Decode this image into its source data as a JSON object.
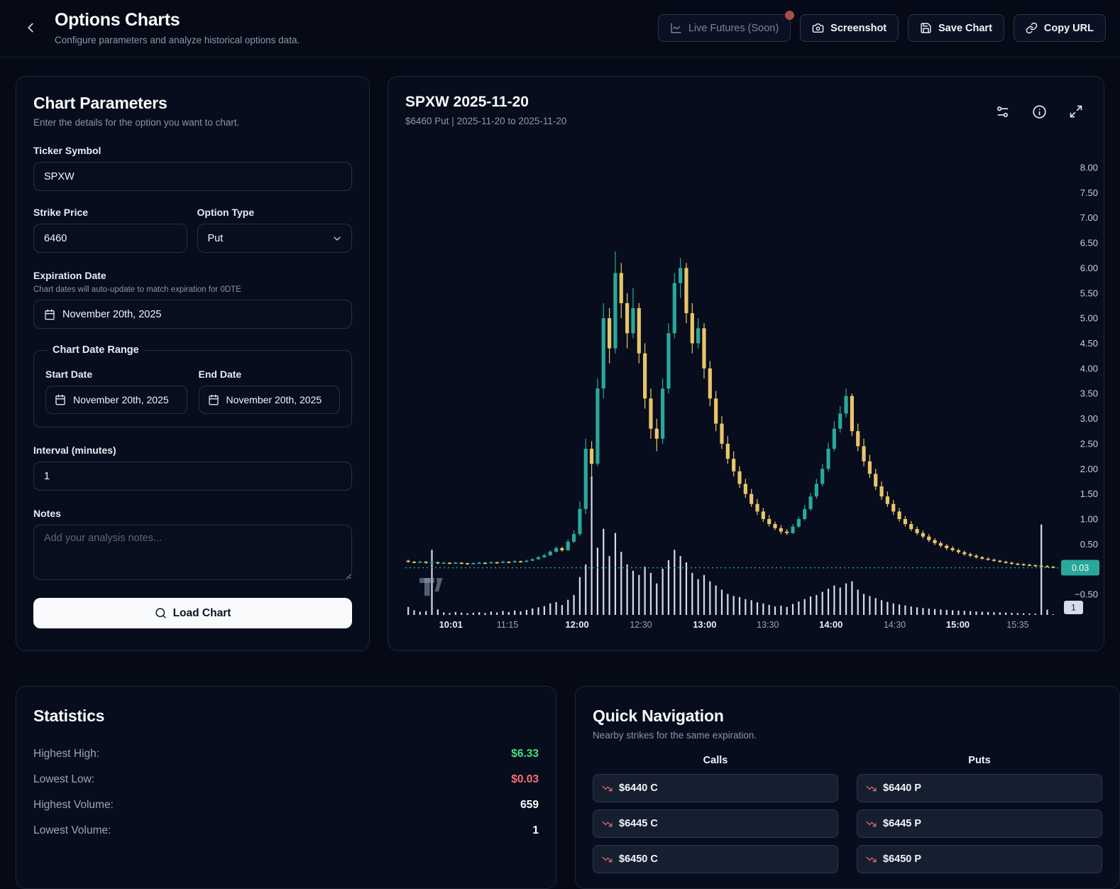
{
  "header": {
    "title": "Options Charts",
    "subtitle": "Configure parameters and analyze historical options data.",
    "live_futures_label": "Live Futures (Soon)",
    "screenshot_label": "Screenshot",
    "save_chart_label": "Save Chart",
    "copy_url_label": "Copy URL",
    "notification_dot_color": "#a84e4b"
  },
  "parameters": {
    "title": "Chart Parameters",
    "subtitle": "Enter the details for the option you want to chart.",
    "ticker_label": "Ticker Symbol",
    "ticker_value": "SPXW",
    "strike_label": "Strike Price",
    "strike_value": "6460",
    "option_type_label": "Option Type",
    "option_type_value": "Put",
    "expiration_label": "Expiration Date",
    "expiration_hint": "Chart dates will auto-update to match expiration for 0DTE",
    "expiration_value": "November 20th, 2025",
    "range_label": "Chart Date Range",
    "start_label": "Start Date",
    "start_value": "November 20th, 2025",
    "end_label": "End Date",
    "end_value": "November 20th, 2025",
    "interval_label": "Interval (minutes)",
    "interval_value": "1",
    "notes_label": "Notes",
    "notes_placeholder": "Add your analysis notes...",
    "load_button_label": "Load Chart"
  },
  "chart": {
    "title": "SPXW 2025-11-20",
    "subtitle": "$6460 Put | 2025-11-20 to 2025-11-20",
    "icons": [
      "settings-sliders",
      "info-circle",
      "maximize"
    ]
  },
  "chart_data": {
    "type": "candlestick",
    "title": "SPXW 2025-11-20 $6460 Put intraday",
    "ylim": [
      -0.9,
      8.55
    ],
    "grid": false,
    "legend_position": "none",
    "up_color": "#2aa79b",
    "down_color": "#e9c46a",
    "volume_color": "rgba(233,238,245,0.92)",
    "last_price": 0.03,
    "last_price_label": "0.03",
    "last_volume_label": "1",
    "price_line_style": "dotted",
    "y_ticks": [
      {
        "v": 8.0,
        "label": "8.00"
      },
      {
        "v": 7.5,
        "label": "7.50"
      },
      {
        "v": 7.0,
        "label": "7.00"
      },
      {
        "v": 6.5,
        "label": "6.50"
      },
      {
        "v": 6.0,
        "label": "6.00"
      },
      {
        "v": 5.5,
        "label": "5.50"
      },
      {
        "v": 5.0,
        "label": "5.00"
      },
      {
        "v": 4.5,
        "label": "4.50"
      },
      {
        "v": 4.0,
        "label": "4.00"
      },
      {
        "v": 3.5,
        "label": "3.50"
      },
      {
        "v": 3.0,
        "label": "3.00"
      },
      {
        "v": 2.5,
        "label": "2.50"
      },
      {
        "v": 2.0,
        "label": "2.00"
      },
      {
        "v": 1.5,
        "label": "1.50"
      },
      {
        "v": 1.0,
        "label": "1.00"
      },
      {
        "v": 0.5,
        "label": "0.50"
      },
      {
        "v": -0.5,
        "label": "−0.50"
      }
    ],
    "x_ticks": [
      {
        "f": 0.07,
        "label": "10:01",
        "bold": true
      },
      {
        "f": 0.157,
        "label": "11:15",
        "bold": false
      },
      {
        "f": 0.264,
        "label": "12:00",
        "bold": true
      },
      {
        "f": 0.362,
        "label": "12:30",
        "bold": false
      },
      {
        "f": 0.46,
        "label": "13:00",
        "bold": true
      },
      {
        "f": 0.557,
        "label": "13:30",
        "bold": false
      },
      {
        "f": 0.654,
        "label": "14:00",
        "bold": true
      },
      {
        "f": 0.752,
        "label": "14:30",
        "bold": false
      },
      {
        "f": 0.849,
        "label": "15:00",
        "bold": true
      },
      {
        "f": 0.941,
        "label": "15:35",
        "bold": false
      }
    ],
    "ohlcv_format": [
      "open",
      "high",
      "low",
      "close",
      "volume"
    ],
    "candles": [
      [
        0.17,
        0.19,
        0.13,
        0.15,
        38
      ],
      [
        0.15,
        0.16,
        0.12,
        0.14,
        22
      ],
      [
        0.14,
        0.17,
        0.13,
        0.15,
        15
      ],
      [
        0.15,
        0.16,
        0.11,
        0.13,
        18
      ],
      [
        0.13,
        0.16,
        0.1,
        0.14,
        310
      ],
      [
        0.14,
        0.15,
        0.1,
        0.12,
        26
      ],
      [
        0.12,
        0.15,
        0.11,
        0.13,
        12
      ],
      [
        0.13,
        0.14,
        0.1,
        0.12,
        9
      ],
      [
        0.12,
        0.15,
        0.11,
        0.13,
        14
      ],
      [
        0.13,
        0.14,
        0.1,
        0.12,
        11
      ],
      [
        0.12,
        0.13,
        0.09,
        0.11,
        8
      ],
      [
        0.11,
        0.14,
        0.1,
        0.12,
        10
      ],
      [
        0.12,
        0.15,
        0.11,
        0.13,
        13
      ],
      [
        0.13,
        0.14,
        0.1,
        0.12,
        9
      ],
      [
        0.12,
        0.16,
        0.11,
        0.14,
        16
      ],
      [
        0.14,
        0.15,
        0.11,
        0.13,
        12
      ],
      [
        0.13,
        0.17,
        0.12,
        0.15,
        19
      ],
      [
        0.15,
        0.16,
        0.12,
        0.14,
        14
      ],
      [
        0.14,
        0.18,
        0.13,
        0.16,
        21
      ],
      [
        0.16,
        0.17,
        0.13,
        0.15,
        17
      ],
      [
        0.15,
        0.19,
        0.14,
        0.17,
        24
      ],
      [
        0.17,
        0.22,
        0.16,
        0.2,
        31
      ],
      [
        0.2,
        0.26,
        0.19,
        0.24,
        36
      ],
      [
        0.24,
        0.31,
        0.22,
        0.28,
        42
      ],
      [
        0.28,
        0.38,
        0.26,
        0.35,
        55
      ],
      [
        0.35,
        0.46,
        0.33,
        0.42,
        61
      ],
      [
        0.42,
        0.45,
        0.35,
        0.38,
        47
      ],
      [
        0.38,
        0.6,
        0.36,
        0.55,
        72
      ],
      [
        0.55,
        0.78,
        0.52,
        0.7,
        95
      ],
      [
        0.7,
        1.35,
        0.66,
        1.2,
        180
      ],
      [
        1.2,
        2.6,
        1.1,
        2.4,
        240
      ],
      [
        2.4,
        2.55,
        1.85,
        2.1,
        659
      ],
      [
        2.1,
        3.8,
        2.05,
        3.6,
        320
      ],
      [
        3.6,
        5.3,
        3.4,
        5.0,
        410
      ],
      [
        5.0,
        5.2,
        4.1,
        4.4,
        280
      ],
      [
        4.4,
        6.33,
        4.3,
        5.9,
        390
      ],
      [
        5.9,
        6.1,
        5.0,
        5.3,
        300
      ],
      [
        5.3,
        5.5,
        4.4,
        4.7,
        240
      ],
      [
        4.7,
        5.6,
        4.6,
        5.2,
        210
      ],
      [
        5.2,
        5.3,
        4.1,
        4.3,
        190
      ],
      [
        4.3,
        4.5,
        3.2,
        3.4,
        230
      ],
      [
        3.4,
        3.6,
        2.6,
        2.8,
        200
      ],
      [
        2.8,
        3.0,
        2.35,
        2.6,
        150
      ],
      [
        2.6,
        3.8,
        2.5,
        3.6,
        220
      ],
      [
        3.6,
        4.9,
        3.5,
        4.7,
        260
      ],
      [
        4.7,
        5.9,
        4.6,
        5.7,
        310
      ],
      [
        5.7,
        6.2,
        5.4,
        6.0,
        280
      ],
      [
        6.0,
        6.1,
        4.9,
        5.1,
        250
      ],
      [
        5.1,
        5.3,
        4.3,
        4.5,
        200
      ],
      [
        4.5,
        5.0,
        4.4,
        4.8,
        170
      ],
      [
        4.8,
        4.9,
        3.8,
        4.0,
        190
      ],
      [
        4.0,
        4.15,
        3.25,
        3.4,
        160
      ],
      [
        3.4,
        3.55,
        2.75,
        2.9,
        140
      ],
      [
        2.9,
        3.05,
        2.4,
        2.5,
        120
      ],
      [
        2.5,
        2.65,
        2.1,
        2.2,
        100
      ],
      [
        2.2,
        2.35,
        1.85,
        1.95,
        90
      ],
      [
        1.95,
        2.05,
        1.62,
        1.7,
        85
      ],
      [
        1.7,
        1.8,
        1.42,
        1.5,
        75
      ],
      [
        1.5,
        1.6,
        1.24,
        1.3,
        70
      ],
      [
        1.3,
        1.4,
        1.08,
        1.15,
        60
      ],
      [
        1.15,
        1.22,
        0.94,
        1.0,
        55
      ],
      [
        1.0,
        1.08,
        0.85,
        0.9,
        48
      ],
      [
        0.9,
        0.95,
        0.78,
        0.82,
        40
      ],
      [
        0.82,
        0.88,
        0.7,
        0.75,
        44
      ],
      [
        0.75,
        0.8,
        0.68,
        0.72,
        38
      ],
      [
        0.72,
        0.9,
        0.7,
        0.85,
        52
      ],
      [
        0.85,
        1.05,
        0.82,
        1.0,
        64
      ],
      [
        1.0,
        1.28,
        0.97,
        1.2,
        75
      ],
      [
        1.2,
        1.52,
        1.16,
        1.45,
        88
      ],
      [
        1.45,
        1.8,
        1.4,
        1.7,
        95
      ],
      [
        1.7,
        2.1,
        1.65,
        2.0,
        110
      ],
      [
        2.0,
        2.52,
        1.95,
        2.4,
        125
      ],
      [
        2.4,
        2.95,
        2.35,
        2.8,
        140
      ],
      [
        2.8,
        3.25,
        2.72,
        3.1,
        130
      ],
      [
        3.1,
        3.6,
        3.02,
        3.45,
        150
      ],
      [
        3.45,
        3.5,
        2.65,
        2.75,
        160
      ],
      [
        2.75,
        2.9,
        2.35,
        2.45,
        120
      ],
      [
        2.45,
        2.6,
        2.05,
        2.15,
        100
      ],
      [
        2.15,
        2.28,
        1.82,
        1.9,
        90
      ],
      [
        1.9,
        2.0,
        1.58,
        1.65,
        80
      ],
      [
        1.65,
        1.75,
        1.38,
        1.45,
        70
      ],
      [
        1.45,
        1.55,
        1.24,
        1.3,
        62
      ],
      [
        1.3,
        1.38,
        1.08,
        1.15,
        55
      ],
      [
        1.15,
        1.22,
        0.95,
        1.0,
        50
      ],
      [
        1.0,
        1.06,
        0.85,
        0.9,
        45
      ],
      [
        0.9,
        0.96,
        0.76,
        0.8,
        40
      ],
      [
        0.8,
        0.85,
        0.68,
        0.72,
        36
      ],
      [
        0.72,
        0.77,
        0.61,
        0.65,
        33
      ],
      [
        0.65,
        0.7,
        0.54,
        0.58,
        30
      ],
      [
        0.58,
        0.62,
        0.48,
        0.52,
        28
      ],
      [
        0.52,
        0.56,
        0.43,
        0.47,
        26
      ],
      [
        0.47,
        0.5,
        0.38,
        0.42,
        24
      ],
      [
        0.42,
        0.46,
        0.35,
        0.38,
        22
      ],
      [
        0.38,
        0.41,
        0.31,
        0.34,
        20
      ],
      [
        0.34,
        0.37,
        0.27,
        0.3,
        19
      ],
      [
        0.3,
        0.33,
        0.24,
        0.27,
        18
      ],
      [
        0.27,
        0.3,
        0.21,
        0.24,
        16
      ],
      [
        0.24,
        0.26,
        0.19,
        0.21,
        15
      ],
      [
        0.21,
        0.24,
        0.17,
        0.19,
        14
      ],
      [
        0.19,
        0.21,
        0.15,
        0.17,
        13
      ],
      [
        0.17,
        0.19,
        0.13,
        0.15,
        12
      ],
      [
        0.15,
        0.17,
        0.11,
        0.13,
        11
      ],
      [
        0.13,
        0.15,
        0.09,
        0.11,
        10
      ],
      [
        0.11,
        0.13,
        0.08,
        0.1,
        9
      ],
      [
        0.1,
        0.12,
        0.07,
        0.09,
        8
      ],
      [
        0.09,
        0.11,
        0.06,
        0.08,
        7
      ],
      [
        0.08,
        0.1,
        0.05,
        0.07,
        6
      ],
      [
        0.07,
        0.09,
        0.04,
        0.06,
        430
      ],
      [
        0.06,
        0.08,
        0.04,
        0.05,
        25
      ],
      [
        0.05,
        0.07,
        0.03,
        0.03,
        1
      ]
    ]
  },
  "stats": {
    "title": "Statistics",
    "rows": [
      {
        "label": "Highest High:",
        "value": "$6.33",
        "color": "#4ade80"
      },
      {
        "label": "Lowest Low:",
        "value": "$0.03",
        "color": "#f87171"
      },
      {
        "label": "Highest Volume:",
        "value": "659",
        "color": "#ffffff"
      },
      {
        "label": "Lowest Volume:",
        "value": "1",
        "color": "#ffffff"
      }
    ]
  },
  "quick_nav": {
    "title": "Quick Navigation",
    "subtitle": "Nearby strikes for the same expiration.",
    "calls_header": "Calls",
    "puts_header": "Puts",
    "calls": [
      "$6440 C",
      "$6445 C",
      "$6450 C"
    ],
    "puts": [
      "$6440 P",
      "$6445 P",
      "$6450 P"
    ]
  }
}
